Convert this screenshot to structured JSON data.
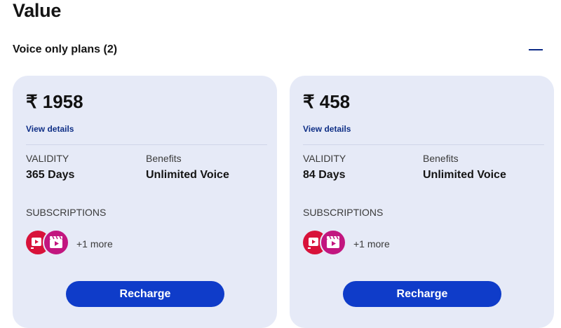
{
  "page": {
    "title": "Value"
  },
  "section": {
    "title": "Voice only plans (2)"
  },
  "plans": [
    {
      "price": "₹ 1958",
      "view_details": "View details",
      "validity_label": "VALIDITY",
      "validity_value": "365 Days",
      "benefits_label": "Benefits",
      "benefits_value": "Unlimited Voice",
      "subscriptions_label": "SUBSCRIPTIONS",
      "subscriptions_more": "+1 more",
      "recharge_label": "Recharge"
    },
    {
      "price": "₹ 458",
      "view_details": "View details",
      "validity_label": "VALIDITY",
      "validity_value": "84 Days",
      "benefits_label": "Benefits",
      "benefits_value": "Unlimited Voice",
      "subscriptions_label": "SUBSCRIPTIONS",
      "subscriptions_more": "+1 more",
      "recharge_label": "Recharge"
    }
  ],
  "icons": {
    "collapse": "minus-icon",
    "subscription_1": "video-play-icon",
    "subscription_2": "clapperboard-icon"
  },
  "colors": {
    "card_bg": "#e6eaf7",
    "button_bg": "#0f3cc9",
    "link": "#0f2f86",
    "icon_red": "#d8123a",
    "icon_pink": "#c2167f"
  }
}
